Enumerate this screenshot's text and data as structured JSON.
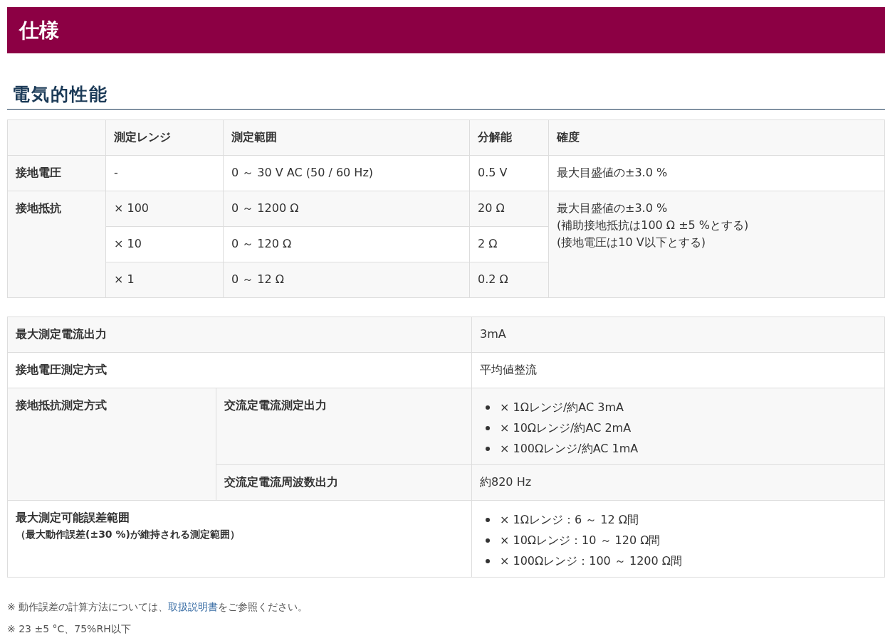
{
  "banner": {
    "title": "仕様"
  },
  "section": {
    "title": "電気的性能"
  },
  "range_table": {
    "columns": [
      "測定レンジ",
      "測定範囲",
      "分解能",
      "確度"
    ],
    "groups": [
      {
        "label": "接地電圧",
        "rows": [
          {
            "range_setting": "-",
            "range": "0 ～ 30 V AC (50 / 60 Hz)",
            "resolution": "0.5 V"
          }
        ],
        "accuracy": [
          "最大目盛値の±3.0 %"
        ]
      },
      {
        "label": "接地抵抗",
        "rows": [
          {
            "range_setting": "× 100",
            "range": "0 ～ 1200 Ω",
            "resolution": "20 Ω"
          },
          {
            "range_setting": "× 10",
            "range": "0 ～ 120 Ω",
            "resolution": "2 Ω"
          },
          {
            "range_setting": "× 1",
            "range": "0 ～ 12 Ω",
            "resolution": "0.2 Ω"
          }
        ],
        "accuracy": [
          "最大目盛値の±3.0 %",
          "(補助接地抵抗は100 Ω ±5 %とする)",
          "(接地電圧は10 V以下とする)"
        ]
      }
    ]
  },
  "spec_table": {
    "rows": [
      {
        "label": "最大測定電流出力",
        "value": "3mA"
      },
      {
        "label": "接地電圧測定方式",
        "value": "平均値整流"
      },
      {
        "label": "接地抵抗測定方式",
        "sub_rows": [
          {
            "label": "交流定電流測定出力",
            "items": [
              "× 1Ωレンジ/約AC 3mA",
              "× 10Ωレンジ/約AC 2mA",
              "× 100Ωレンジ/約AC 1mA"
            ]
          },
          {
            "label": "交流定電流周波数出力",
            "value": "約820 Hz"
          }
        ]
      },
      {
        "label": "最大測定可能誤差範囲",
        "note": "（最大動作誤差(±30 %)が維持される測定範囲）",
        "items": [
          "× 1Ωレンジ：6 ～ 12 Ω間",
          "× 10Ωレンジ：10 ～ 120 Ω間",
          "× 100Ωレンジ：100 ～ 1200 Ω間"
        ]
      }
    ]
  },
  "footnotes": [
    {
      "before": "※ 動作誤差の計算方法については、",
      "link": "取扱説明書",
      "after": "をご参照ください。"
    },
    {
      "before": "※ 23 ±5 °C、75%RH以下"
    }
  ]
}
